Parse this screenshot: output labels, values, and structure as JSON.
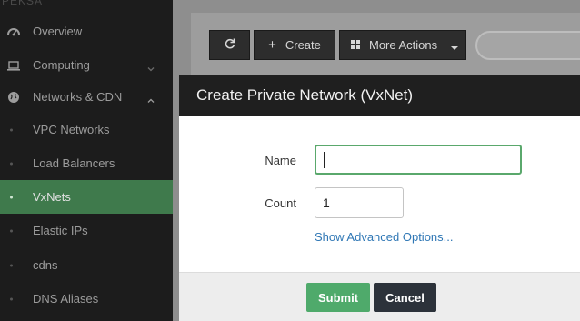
{
  "sidebar": {
    "brand": "PEKSA",
    "items": [
      {
        "label": "Overview",
        "icon": "dashboard-icon"
      },
      {
        "label": "Computing",
        "icon": "laptop-icon",
        "chevron": "chevron-down-icon"
      },
      {
        "label": "Networks & CDN",
        "icon": "globe-icon",
        "chevron": "chevron-up-icon"
      }
    ],
    "subitems": [
      {
        "label": "VPC Networks"
      },
      {
        "label": "Load Balancers"
      },
      {
        "label": "VxNets",
        "active": true
      },
      {
        "label": "Elastic IPs"
      },
      {
        "label": "cdns"
      },
      {
        "label": "DNS Aliases"
      }
    ]
  },
  "toolbar": {
    "refresh_icon": "refresh-icon",
    "create_label": "Create",
    "more_actions_label": "More Actions"
  },
  "modal": {
    "title": "Create Private Network (VxNet)",
    "name_label": "Name",
    "name_value": "",
    "count_label": "Count",
    "count_value": "1",
    "advanced_link": "Show Advanced Options...",
    "submit_label": "Submit",
    "cancel_label": "Cancel"
  },
  "colors": {
    "sidebar_bg": "#1c1c1c",
    "active_item": "#3f7a4c",
    "modal_header": "#1f1f1f",
    "submit": "#4faa6b",
    "cancel": "#2c323a",
    "link": "#2f77b5",
    "focus_border": "#5aa86c"
  }
}
